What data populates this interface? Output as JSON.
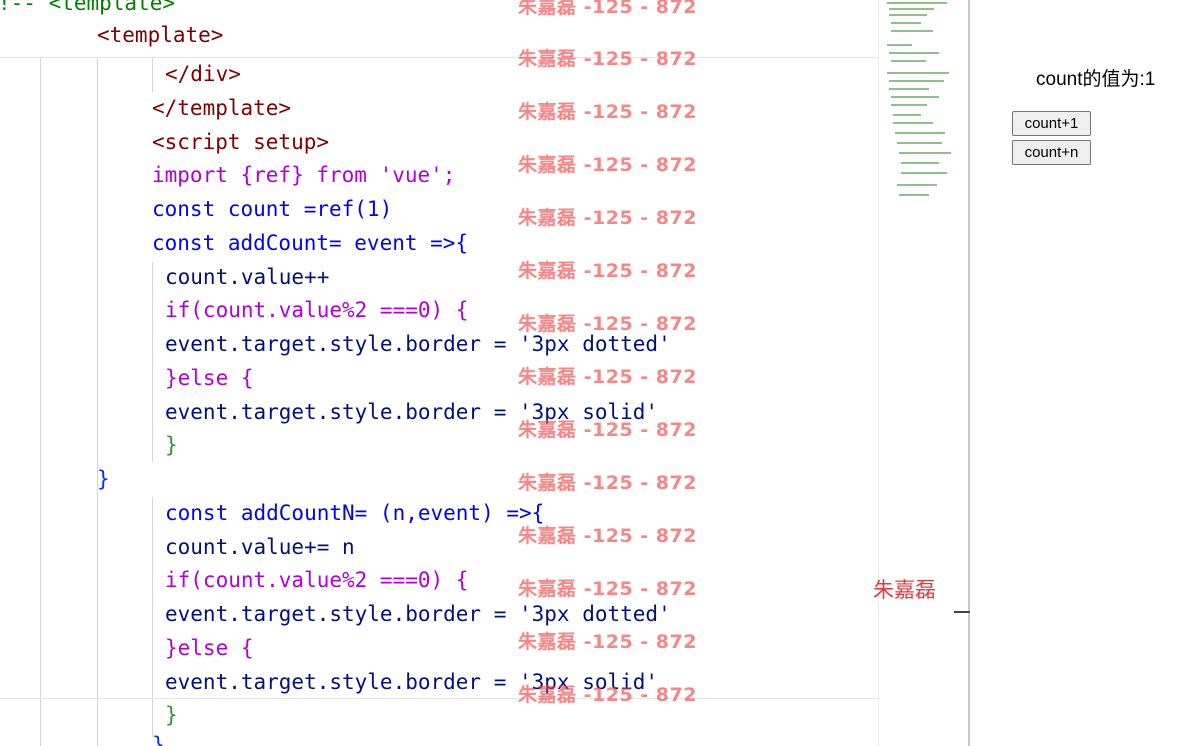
{
  "editor": {
    "lines": [
      "!-- <template>",
      "<template>",
      "</div>",
      "</template>",
      "<script setup>",
      "import {ref} from 'vue';",
      "const count =ref(1)",
      "const addCount= event =>{",
      "count.value++",
      "if(count.value%2 ===0) {",
      "event.target.style.border = '3px dotted'",
      "}else {",
      "event.target.style.border = '3px solid'",
      "}",
      "}",
      "const addCountN= (n,event) =>{",
      "count.value+= n",
      "if(count.value%2 ===0) {",
      "event.target.style.border = '3px dotted'",
      "}else {",
      "event.target.style.border = '3px solid'",
      "}",
      "}"
    ]
  },
  "watermark": {
    "text": "朱嘉磊 -125 - 872",
    "name": "朱嘉磊"
  },
  "preview": {
    "count_label": "count的值为:1",
    "btn_count1": "count+1",
    "btn_countn": "count+n"
  },
  "colors": {
    "keyword": "#af00db",
    "blue": "#0000ff",
    "tag": "#800000",
    "string": "#a31515",
    "variable": "#001080",
    "function": "#795e26",
    "number": "#098658",
    "watermark": "#f04646"
  }
}
